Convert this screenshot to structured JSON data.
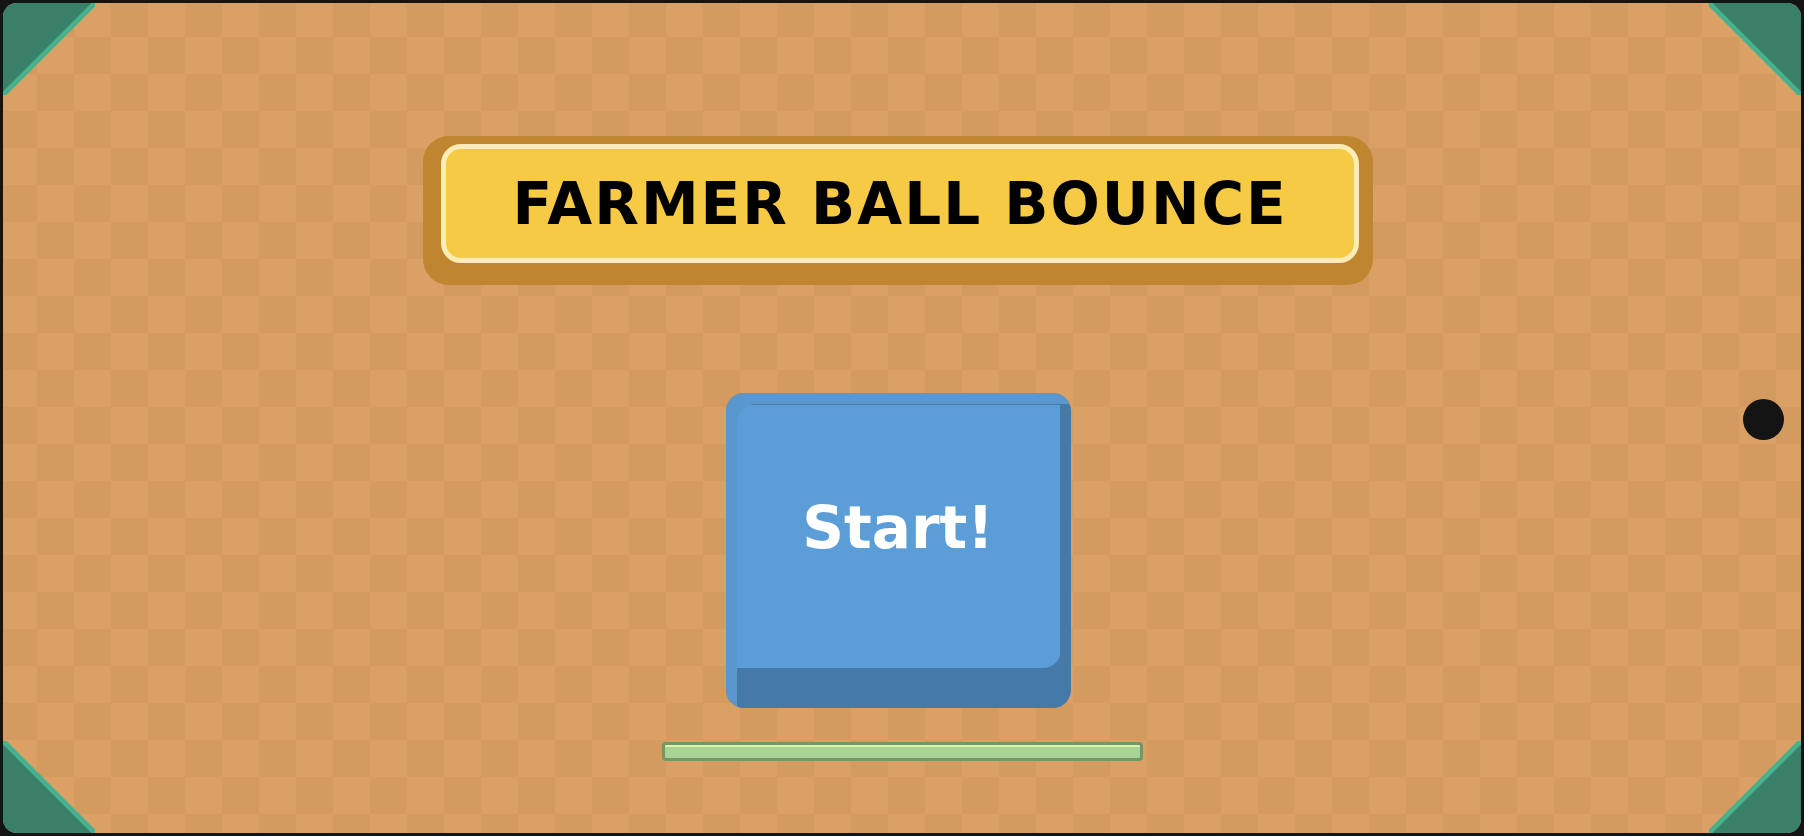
{
  "title": "FARMER BALL BOUNCE",
  "start_button": {
    "label": "Start!"
  }
}
